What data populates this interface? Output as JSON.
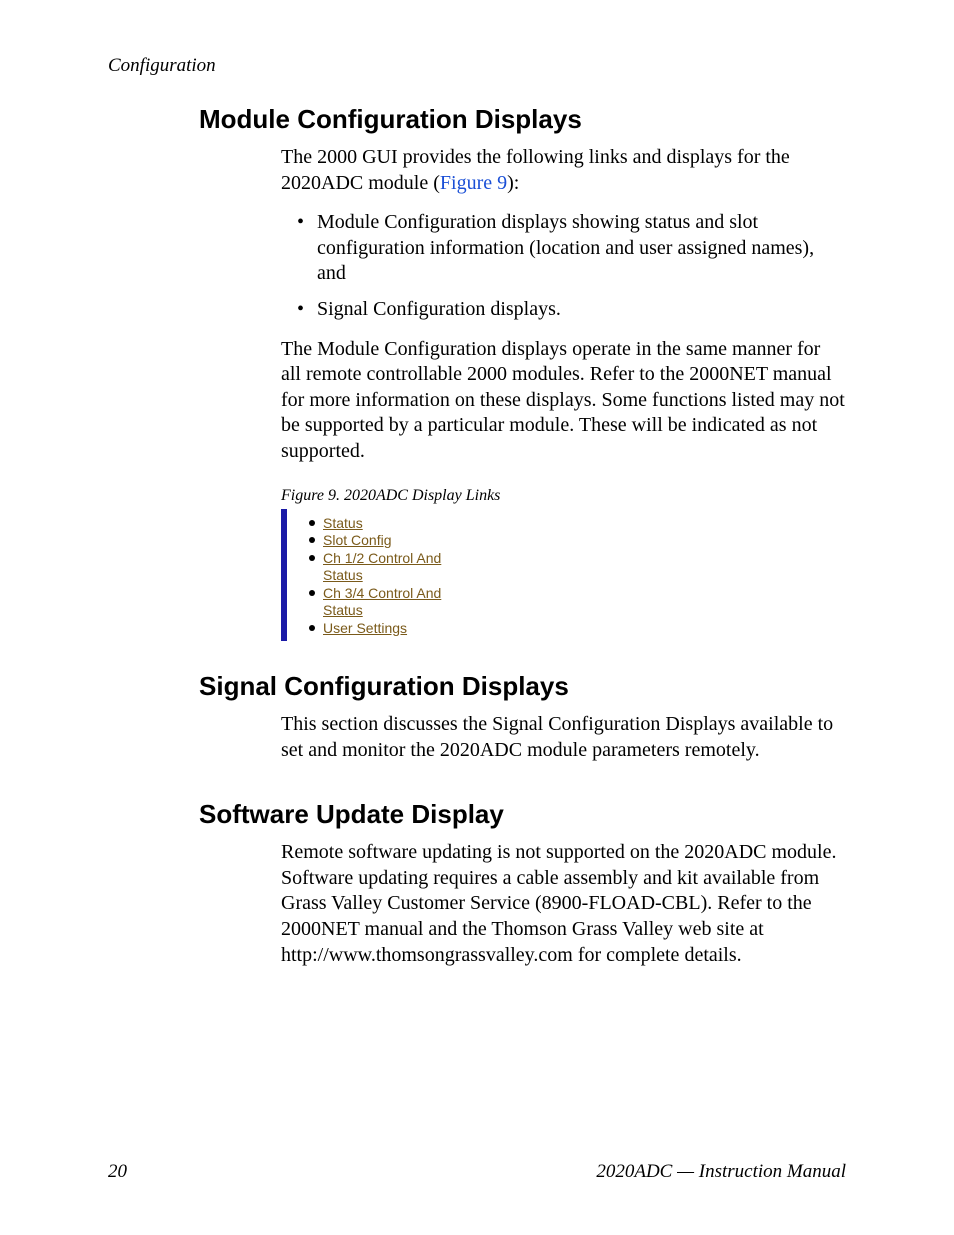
{
  "running_head": "Configuration",
  "sections": {
    "mod_conf": {
      "heading": "Module Configuration Displays",
      "p1_a": "The 2000 GUI provides the following links and displays for the 2020ADC module (",
      "p1_link": "Figure 9",
      "p1_b": "):",
      "bullets": [
        "Module Configuration displays showing status and slot configuration information (location and user assigned names), and",
        "Signal Configuration displays."
      ],
      "p2": "The Module Configuration displays operate in the same manner for all remote controllable 2000 modules. Refer to the 2000NET manual for more information on these displays. Some functions listed may not be supported by a particular module. These will be indicated as not supported.",
      "figcap": "Figure 9.  2020ADC Display Links",
      "figlinks": {
        "l0": "Status",
        "l1": "Slot Config",
        "l2": "Ch 1/2 Control And",
        "l2b": "Status",
        "l3": "Ch 3/4 Control And",
        "l3b": "Status",
        "l4": "User Settings"
      }
    },
    "sig_conf": {
      "heading": "Signal Configuration Displays",
      "p1": "This section discusses the Signal Configuration Displays available to set and monitor the 2020ADC module parameters remotely."
    },
    "sw_upd": {
      "heading": "Software Update Display",
      "p1": "Remote software updating is not supported on the 2020ADC module. Soft­ware updating requires a cable assembly and kit available from Grass Valley Customer Service (8900-FLOAD-CBL). Refer to the 2000NET manual and the Thomson Grass Valley web site at http://www.thomsongrassvalley.com for complete details."
    }
  },
  "footer": {
    "page": "20",
    "title": "2020ADC — Instruction Manual"
  }
}
